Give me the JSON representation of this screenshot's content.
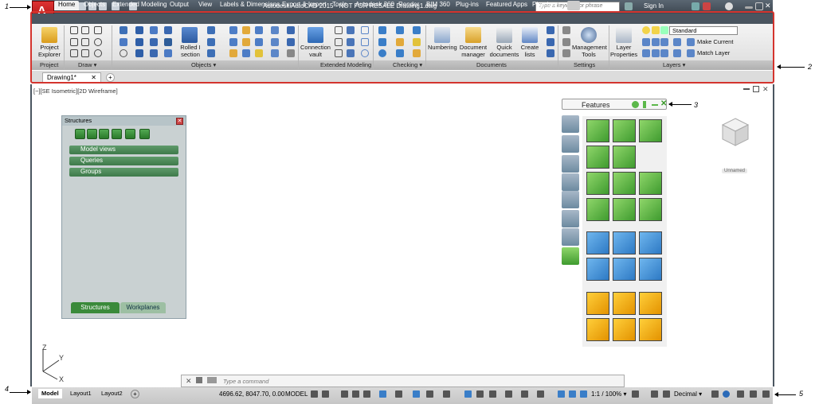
{
  "app": {
    "title": "Autodesk AutoCAD 2015 - NOT FOR RESALE   Drawing1.dwg",
    "app_button": "A",
    "search_placeholder": "Type a keyword or phrase",
    "sign_in": "Sign In"
  },
  "ribbon_tabs": [
    "Home",
    "Objects",
    "Extended Modeling",
    "Output",
    "View",
    "Labels & Dimensions",
    "Export & Import",
    "Tools",
    "Autodesk 360",
    "Render",
    "BIM 360",
    "Plug-ins",
    "Featured Apps",
    "Plug-ins"
  ],
  "ribbon": {
    "project_explorer": "Project Explorer",
    "rolled_isection": "Rolled I section",
    "connection_vault": "Connection vault",
    "numbering": "Numbering",
    "document_manager": "Document manager",
    "quick_documents": "Quick documents",
    "create_lists": "Create lists",
    "management_tools": "Management Tools",
    "layer_properties": "Layer Properties",
    "layer_dropdown": "Standard",
    "make_current": "Make Current",
    "match_layer": "Match Layer",
    "panels": [
      "Project",
      "Draw ▾",
      "Objects ▾",
      "Extended Modeling",
      "Checking ▾",
      "Documents",
      "Settings",
      "Layers ▾"
    ]
  },
  "document": {
    "tab": "Drawing1*",
    "viewport_label": "[−][SE Isometric][2D Wireframe]"
  },
  "structures": {
    "title": "Structures",
    "sections": [
      "Model views",
      "Queries",
      "Groups"
    ],
    "tabs": [
      "Structures",
      "Workplanes"
    ]
  },
  "features": {
    "title": "Features"
  },
  "viewcube": {
    "label": "Unnamed"
  },
  "command": {
    "placeholder": "Type a command"
  },
  "status": {
    "layout_tabs": [
      "Model",
      "Layout1",
      "Layout2"
    ],
    "coordinates": "4696.62, 8047.70, 0.00",
    "mode": "MODEL",
    "scale": "1:1 / 100% ▾",
    "units": "Decimal ▾"
  },
  "callouts": [
    "1",
    "2",
    "3",
    "4",
    "5"
  ],
  "colors": {
    "highlight_frame": "#d4342e",
    "title_bg": "#4a5560",
    "feature_green": "#5cb84a",
    "feature_blue": "#3b8fd8",
    "feature_orange": "#f0a800"
  }
}
